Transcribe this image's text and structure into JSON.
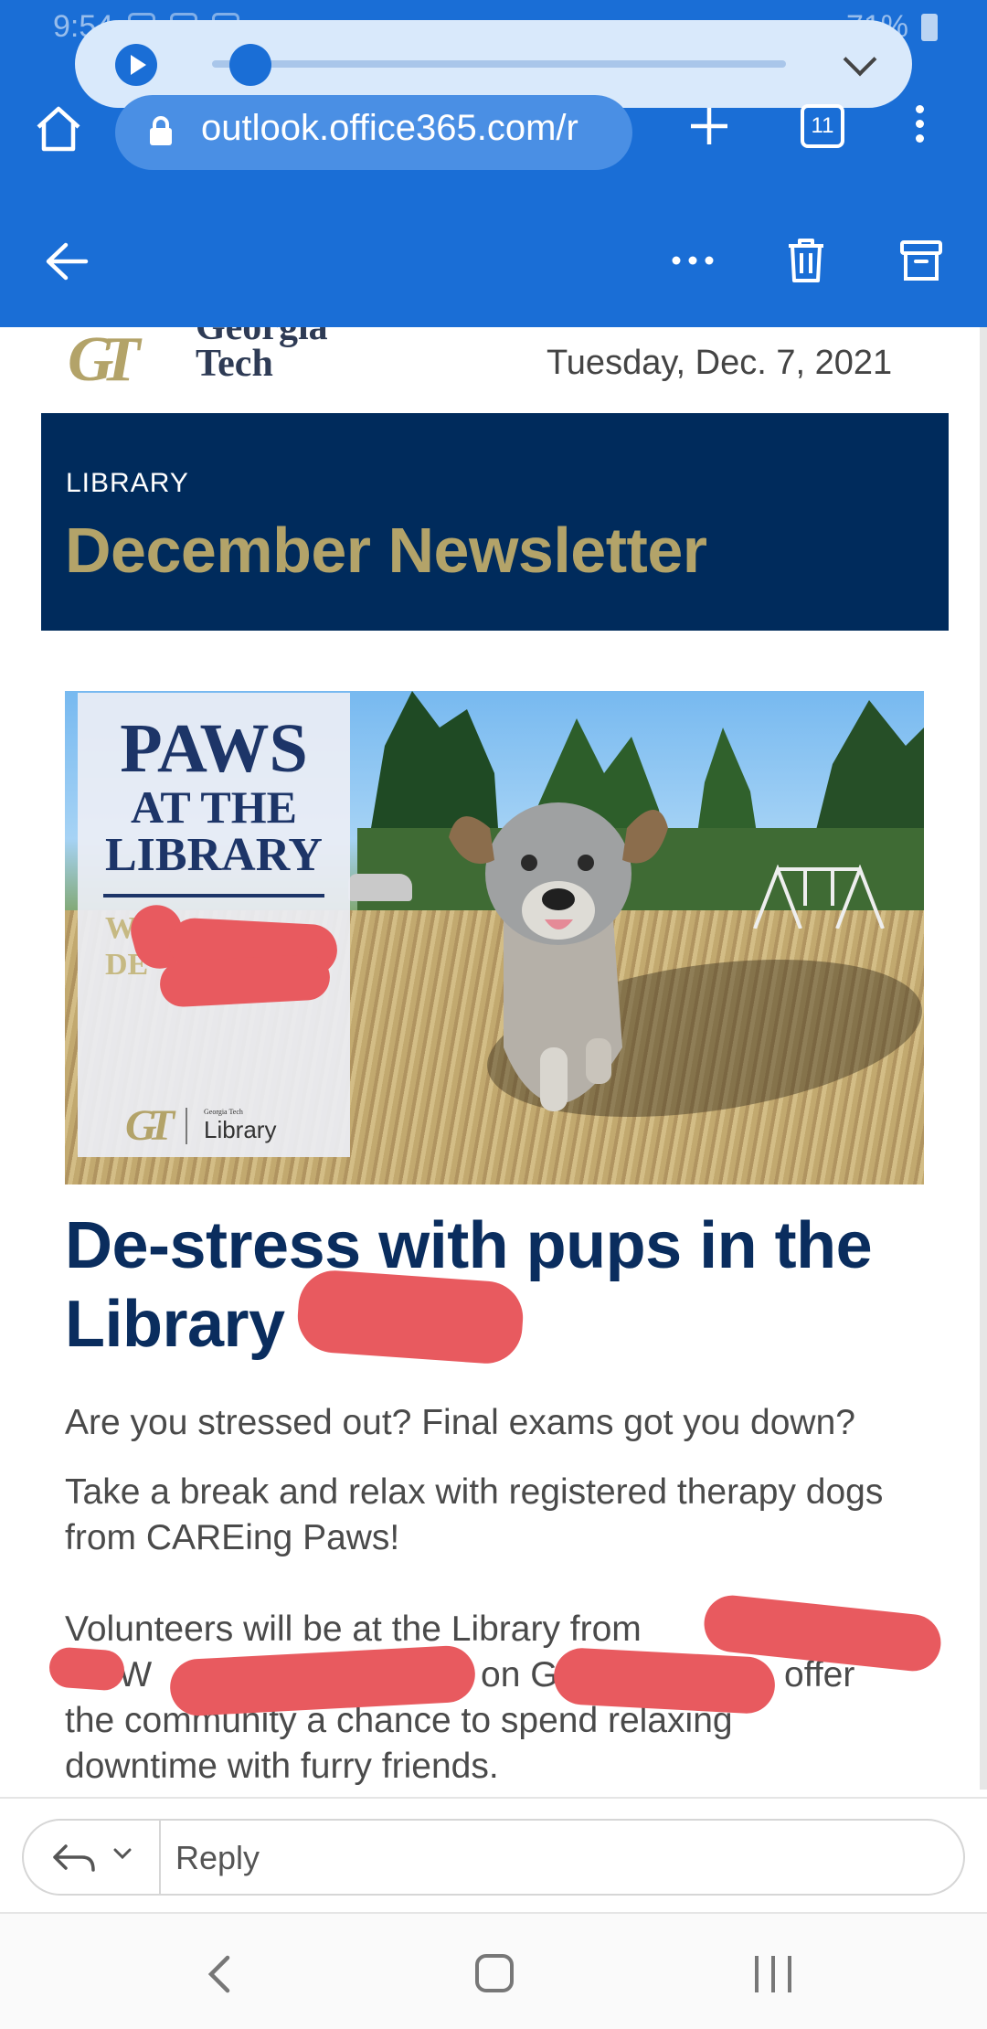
{
  "status_bar": {
    "time": "9:54",
    "battery": "71%"
  },
  "browser": {
    "url": "outlook.office365.com/r",
    "tab_count": "11",
    "media_progress": 0.03
  },
  "email": {
    "logo_text": "Georgia Tech",
    "logo_monogram": "GT",
    "date": "Tuesday, Dec. 7,  2021",
    "banner": {
      "kicker": "LIBRARY",
      "title": "December Newsletter"
    },
    "hero": {
      "line1": "PAWS",
      "line2": "AT THE",
      "line3": "LIBRARY",
      "sub1": "W",
      "sub2": "DE",
      "footer_monogram": "GT",
      "footer_small": "Georgia Tech",
      "footer_label": "Library"
    },
    "article": {
      "title": "De-stress with pups in the Library",
      "p1": "Are you stressed out? Final exams got you down?",
      "p2": "Take a break and relax with registered therapy dogs from CAREing Paws!",
      "p3_line1": "Volunteers will be at the Library from",
      "p3_line2_a": "n. W",
      "p3_line2_b": "on G",
      "p3_line2_c": "offer",
      "p3_line3": "the community a chance to spend relaxing",
      "p3_line4": "downtime with furry friends."
    }
  },
  "reply": {
    "label": "Reply"
  },
  "colors": {
    "outlook_blue": "#1a6ed6",
    "gt_navy": "#002b5c",
    "gt_gold": "#b3a369",
    "redaction": "#e85a5f"
  },
  "icons": [
    "home-icon",
    "lock-icon",
    "plus-icon",
    "kebab-icon",
    "back-arrow-icon",
    "more-icon",
    "trash-icon",
    "archive-icon",
    "reply-icon",
    "chevron-down-icon",
    "nav-back-icon",
    "nav-home-icon",
    "nav-recents-icon"
  ]
}
